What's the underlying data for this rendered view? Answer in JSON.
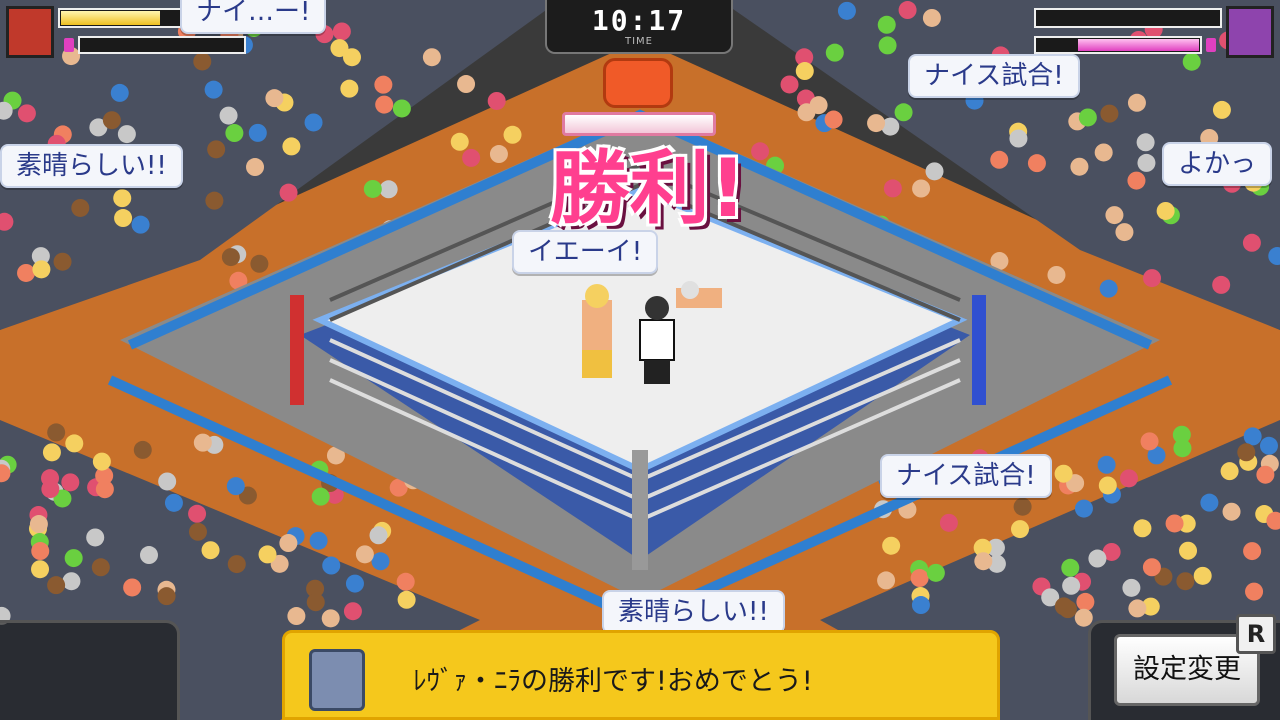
{
  "timer": {
    "value": "10:17",
    "label": "TIME"
  },
  "players": {
    "left": {
      "hp_fraction": 0.55,
      "sp_fraction": 0.0,
      "hp_color": "#f0c020",
      "portrait_color": "#c0392b"
    },
    "right": {
      "hp_fraction": 0.0,
      "sp_fraction": 0.75,
      "sp_color": "#e040c0",
      "portrait_color": "#8e44ad"
    }
  },
  "victory": {
    "text": "勝利!"
  },
  "bubbles": {
    "top_left_partial": "ナイ…ー!",
    "left": "素晴らしい!!",
    "center": "イエーイ!",
    "top_right": "ナイス試合!",
    "right_partial": "よかっ",
    "lower_right": "ナイス試合!",
    "bottom": "素晴らしい!!"
  },
  "message": {
    "text": "ﾚｳﾞｧ・ﾆﾗの勝利です!おめでとう!"
  },
  "settings": {
    "label": "設定変更",
    "key_hint": "R"
  },
  "colors": {
    "ring_mat": "#eeeeee",
    "ring_apron": "#3a5aa8",
    "floor_wood": "#c8702a",
    "barrier_blue": "#2f7fd0",
    "accent_pink": "#ff3f8f",
    "message_yellow": "#f5c81c"
  }
}
